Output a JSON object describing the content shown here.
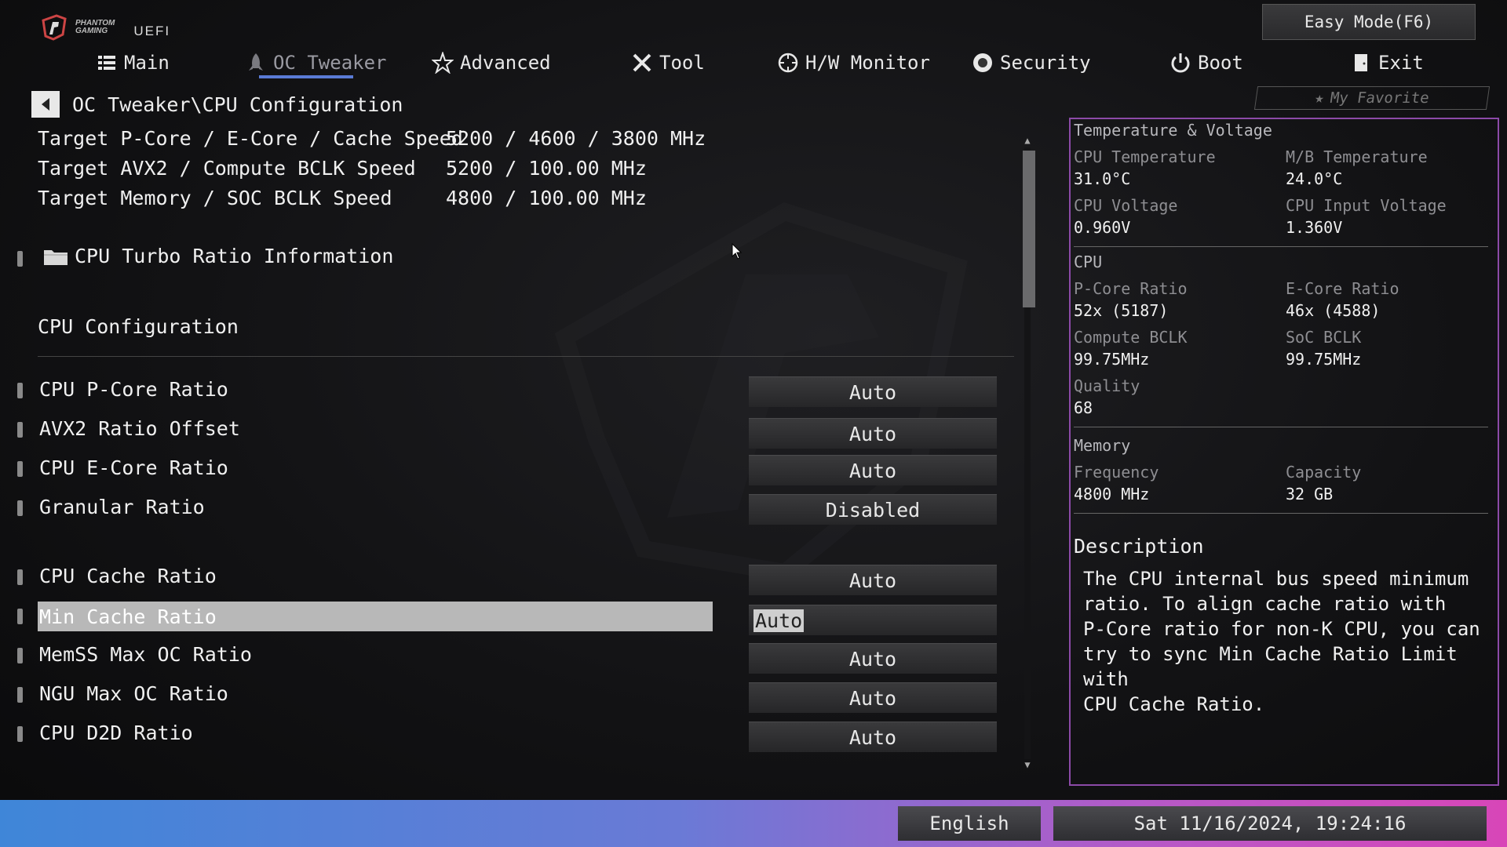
{
  "brand": {
    "line1": "PHANTOM",
    "line2": "GAMING",
    "uefi": "UEFI"
  },
  "easy_mode": "Easy Mode(F6)",
  "tabs": [
    {
      "label": "Main",
      "icon": "list-icon"
    },
    {
      "label": "OC Tweaker",
      "icon": "rocket-icon",
      "active": true
    },
    {
      "label": "Advanced",
      "icon": "star-icon"
    },
    {
      "label": "Tool",
      "icon": "tools-icon"
    },
    {
      "label": "H/W Monitor",
      "icon": "monitor-icon"
    },
    {
      "label": "Security",
      "icon": "shield-icon"
    },
    {
      "label": "Boot",
      "icon": "power-icon"
    },
    {
      "label": "Exit",
      "icon": "exit-door-icon"
    }
  ],
  "favorite": "My Favorite",
  "breadcrumb": "OC Tweaker\\CPU Configuration",
  "info": [
    {
      "label": "Target P-Core / E-Core / Cache Speed",
      "value": "5200 / 4600 / 3800 MHz"
    },
    {
      "label": "Target AVX2 / Compute BCLK Speed",
      "value": "5200 / 100.00 MHz"
    },
    {
      "label": "Target Memory / SOC BCLK Speed",
      "value": "4800 / 100.00 MHz"
    }
  ],
  "submenu": "CPU Turbo Ratio Information",
  "section_title": "CPU Configuration",
  "options": [
    {
      "label": "CPU P-Core Ratio",
      "value": "Auto"
    },
    {
      "label": "AVX2 Ratio Offset",
      "value": "Auto"
    },
    {
      "label": "CPU E-Core Ratio",
      "value": "Auto"
    },
    {
      "label": "Granular Ratio",
      "value": "Disabled"
    },
    {
      "label": "CPU Cache  Ratio",
      "value": "Auto"
    },
    {
      "label": "Min Cache  Ratio",
      "value": "Auto",
      "selected": true
    },
    {
      "label": "MemSS Max OC Ratio",
      "value": "Auto"
    },
    {
      "label": "NGU Max OC Ratio",
      "value": "Auto"
    },
    {
      "label": "CPU D2D Ratio",
      "value": "Auto"
    }
  ],
  "panel": {
    "temp_title": "Temperature & Voltage",
    "cpu_temp_label": "CPU Temperature",
    "cpu_temp": "31.0°C",
    "mb_temp_label": "M/B Temperature",
    "mb_temp": "24.0°C",
    "cpu_volt_label": "CPU Voltage",
    "cpu_volt": "0.960V",
    "cpu_in_volt_label": "CPU Input Voltage",
    "cpu_in_volt": "1.360V",
    "cpu_title": "CPU",
    "pcore_label": "P-Core Ratio",
    "pcore": "52x (5187)",
    "ecore_label": "E-Core Ratio",
    "ecore": "46x (4588)",
    "bclk_label": "Compute BCLK",
    "bclk": "99.75MHz",
    "soc_label": "SoC BCLK",
    "soc": "99.75MHz",
    "quality_label": "Quality",
    "quality": "68",
    "mem_title": "Memory",
    "freq_label": "Frequency",
    "freq": "4800 MHz",
    "cap_label": "Capacity",
    "cap": "32 GB",
    "desc_title": "Description",
    "desc_text": "The CPU internal bus speed minimum\nratio. To align cache ratio with\nP-Core ratio for non-K CPU, you can\ntry to sync Min Cache Ratio Limit with\nCPU Cache Ratio."
  },
  "footer": {
    "language": "English",
    "datetime": "Sat 11/16/2024, 19:24:16"
  },
  "colors": {
    "panel_border": "#8c4aa8",
    "tab_underline": "#5a7bd6",
    "footer_left": "#3f86d8",
    "footer_right": "#d846b8"
  }
}
